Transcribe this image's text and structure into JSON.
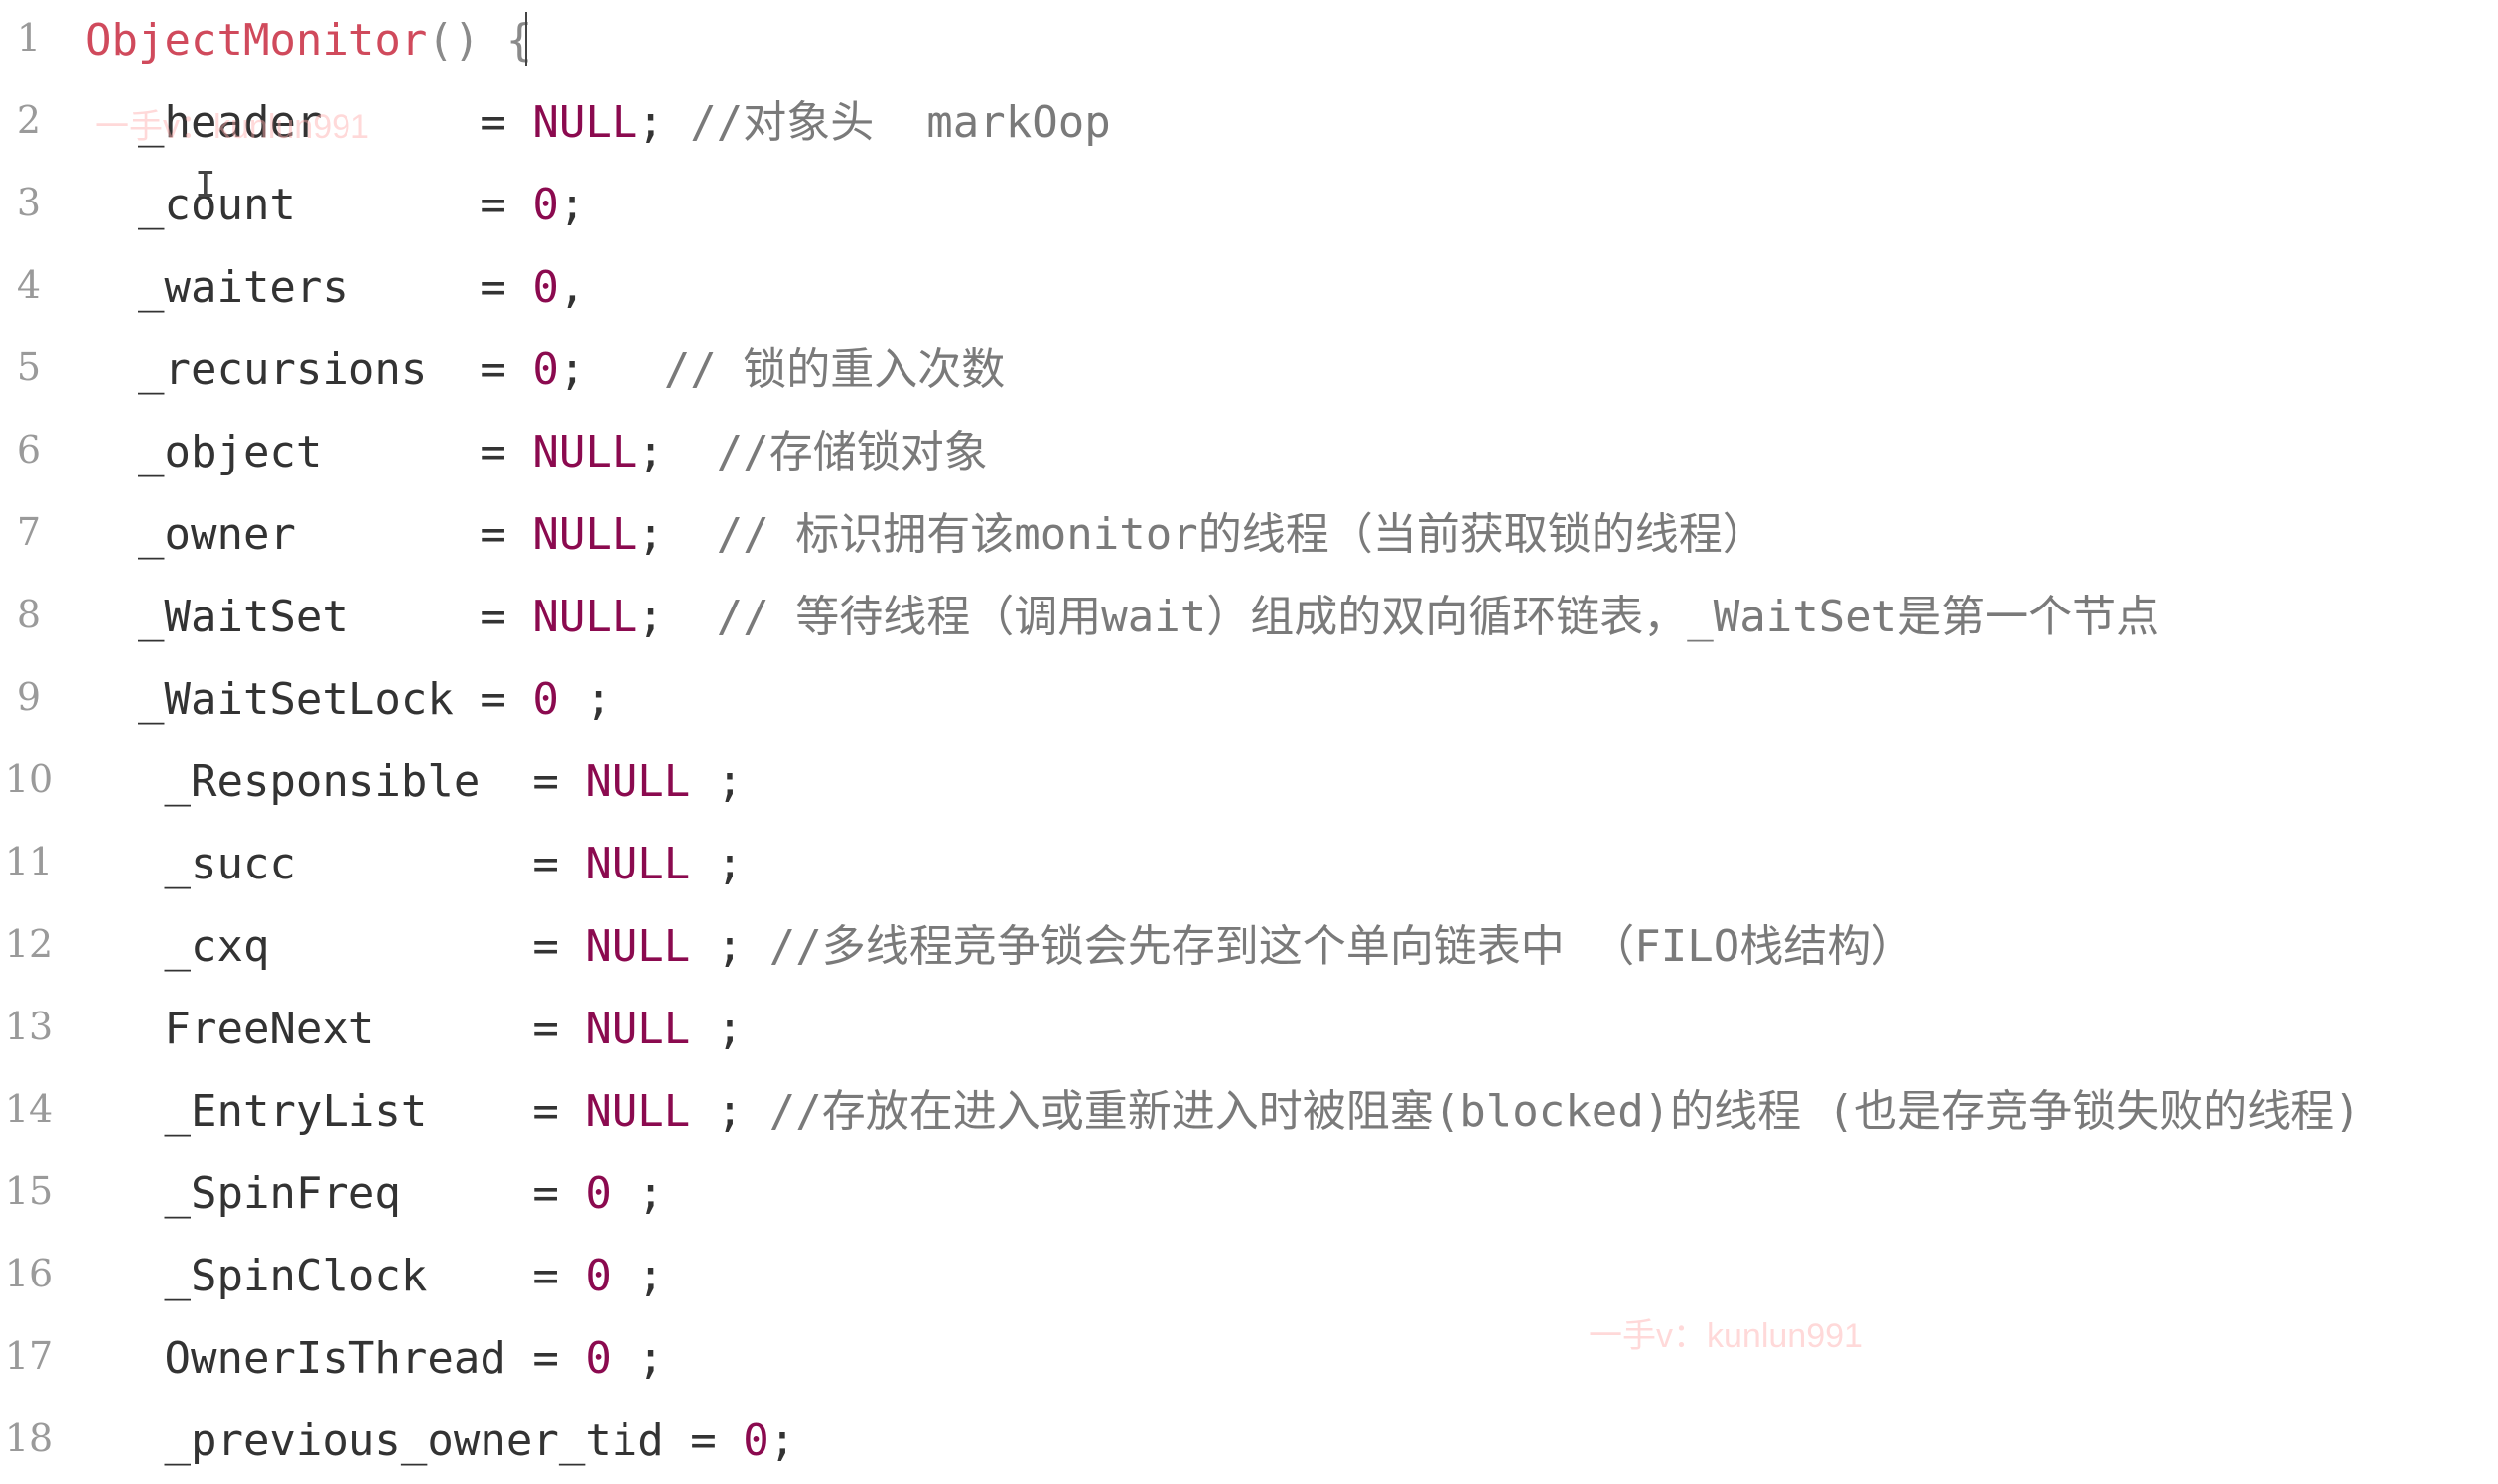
{
  "colors": {
    "function_name": "#d04a5c",
    "keyword": "#8b0a4f",
    "comment": "#7a7a7a",
    "line_number": "#9a9a9a",
    "text": "#333333"
  },
  "watermarks": [
    "一手v：kunlun991",
    "一手v：kunlun991"
  ],
  "lines": [
    {
      "number": "1",
      "tokens": [
        {
          "t": "ObjectMonitor",
          "k": "fn"
        },
        {
          "t": "() {",
          "k": "punct"
        }
      ]
    },
    {
      "number": "2",
      "tokens": [
        {
          "t": "  _header      ",
          "k": "field"
        },
        {
          "t": "= ",
          "k": "op"
        },
        {
          "t": "NULL",
          "k": "kw"
        },
        {
          "t": "; ",
          "k": "op"
        },
        {
          "t": "//对象头  markOop",
          "k": "cmt"
        }
      ]
    },
    {
      "number": "3",
      "tokens": [
        {
          "t": "  _count       ",
          "k": "field"
        },
        {
          "t": "= ",
          "k": "op"
        },
        {
          "t": "0",
          "k": "num"
        },
        {
          "t": ";",
          "k": "op"
        }
      ]
    },
    {
      "number": "4",
      "tokens": [
        {
          "t": "  _waiters     ",
          "k": "field"
        },
        {
          "t": "= ",
          "k": "op"
        },
        {
          "t": "0",
          "k": "num"
        },
        {
          "t": ",",
          "k": "op"
        }
      ]
    },
    {
      "number": "5",
      "tokens": [
        {
          "t": "  _recursions  ",
          "k": "field"
        },
        {
          "t": "= ",
          "k": "op"
        },
        {
          "t": "0",
          "k": "num"
        },
        {
          "t": ";   ",
          "k": "op"
        },
        {
          "t": "// 锁的重入次数",
          "k": "cmt"
        }
      ]
    },
    {
      "number": "6",
      "tokens": [
        {
          "t": "  _object      ",
          "k": "field"
        },
        {
          "t": "= ",
          "k": "op"
        },
        {
          "t": "NULL",
          "k": "kw"
        },
        {
          "t": ";  ",
          "k": "op"
        },
        {
          "t": "//存储锁对象",
          "k": "cmt"
        }
      ]
    },
    {
      "number": "7",
      "tokens": [
        {
          "t": "  _owner       ",
          "k": "field"
        },
        {
          "t": "= ",
          "k": "op"
        },
        {
          "t": "NULL",
          "k": "kw"
        },
        {
          "t": ";  ",
          "k": "op"
        },
        {
          "t": "// 标识拥有该monitor的线程（当前获取锁的线程）",
          "k": "cmt"
        }
      ]
    },
    {
      "number": "8",
      "tokens": [
        {
          "t": "  _WaitSet     ",
          "k": "field"
        },
        {
          "t": "= ",
          "k": "op"
        },
        {
          "t": "NULL",
          "k": "kw"
        },
        {
          "t": ";  ",
          "k": "op"
        },
        {
          "t": "// 等待线程（调用wait）组成的双向循环链表，_WaitSet是第一个节点",
          "k": "cmt"
        }
      ]
    },
    {
      "number": "9",
      "tokens": [
        {
          "t": "  _WaitSetLock ",
          "k": "field"
        },
        {
          "t": "= ",
          "k": "op"
        },
        {
          "t": "0",
          "k": "num"
        },
        {
          "t": " ;",
          "k": "op"
        }
      ]
    },
    {
      "number": "10",
      "tokens": [
        {
          "t": "   _Responsible  ",
          "k": "field"
        },
        {
          "t": "= ",
          "k": "op"
        },
        {
          "t": "NULL",
          "k": "kw"
        },
        {
          "t": " ;",
          "k": "op"
        }
      ]
    },
    {
      "number": "11",
      "tokens": [
        {
          "t": "   _succ         ",
          "k": "field"
        },
        {
          "t": "= ",
          "k": "op"
        },
        {
          "t": "NULL",
          "k": "kw"
        },
        {
          "t": " ;",
          "k": "op"
        }
      ]
    },
    {
      "number": "12",
      "tokens": [
        {
          "t": "   _cxq          ",
          "k": "field"
        },
        {
          "t": "= ",
          "k": "op"
        },
        {
          "t": "NULL",
          "k": "kw"
        },
        {
          "t": " ; ",
          "k": "op"
        },
        {
          "t": "//多线程竞争锁会先存到这个单向链表中 （FILO栈结构）",
          "k": "cmt"
        }
      ]
    },
    {
      "number": "13",
      "tokens": [
        {
          "t": "   FreeNext      ",
          "k": "field"
        },
        {
          "t": "= ",
          "k": "op"
        },
        {
          "t": "NULL",
          "k": "kw"
        },
        {
          "t": " ;",
          "k": "op"
        }
      ]
    },
    {
      "number": "14",
      "tokens": [
        {
          "t": "   _EntryList    ",
          "k": "field"
        },
        {
          "t": "= ",
          "k": "op"
        },
        {
          "t": "NULL",
          "k": "kw"
        },
        {
          "t": " ; ",
          "k": "op"
        },
        {
          "t": "//存放在进入或重新进入时被阻塞(blocked)的线程 (也是存竞争锁失败的线程)",
          "k": "cmt"
        }
      ]
    },
    {
      "number": "15",
      "tokens": [
        {
          "t": "   _SpinFreq     ",
          "k": "field"
        },
        {
          "t": "= ",
          "k": "op"
        },
        {
          "t": "0",
          "k": "num"
        },
        {
          "t": " ;",
          "k": "op"
        }
      ]
    },
    {
      "number": "16",
      "tokens": [
        {
          "t": "   _SpinClock    ",
          "k": "field"
        },
        {
          "t": "= ",
          "k": "op"
        },
        {
          "t": "0",
          "k": "num"
        },
        {
          "t": " ;",
          "k": "op"
        }
      ]
    },
    {
      "number": "17",
      "tokens": [
        {
          "t": "   OwnerIsThread ",
          "k": "field"
        },
        {
          "t": "= ",
          "k": "op"
        },
        {
          "t": "0",
          "k": "num"
        },
        {
          "t": " ;",
          "k": "op"
        }
      ]
    },
    {
      "number": "18",
      "tokens": [
        {
          "t": "   _previous_owner_tid ",
          "k": "field"
        },
        {
          "t": "= ",
          "k": "op"
        },
        {
          "t": "0",
          "k": "num"
        },
        {
          "t": ";",
          "k": "op"
        }
      ]
    }
  ]
}
